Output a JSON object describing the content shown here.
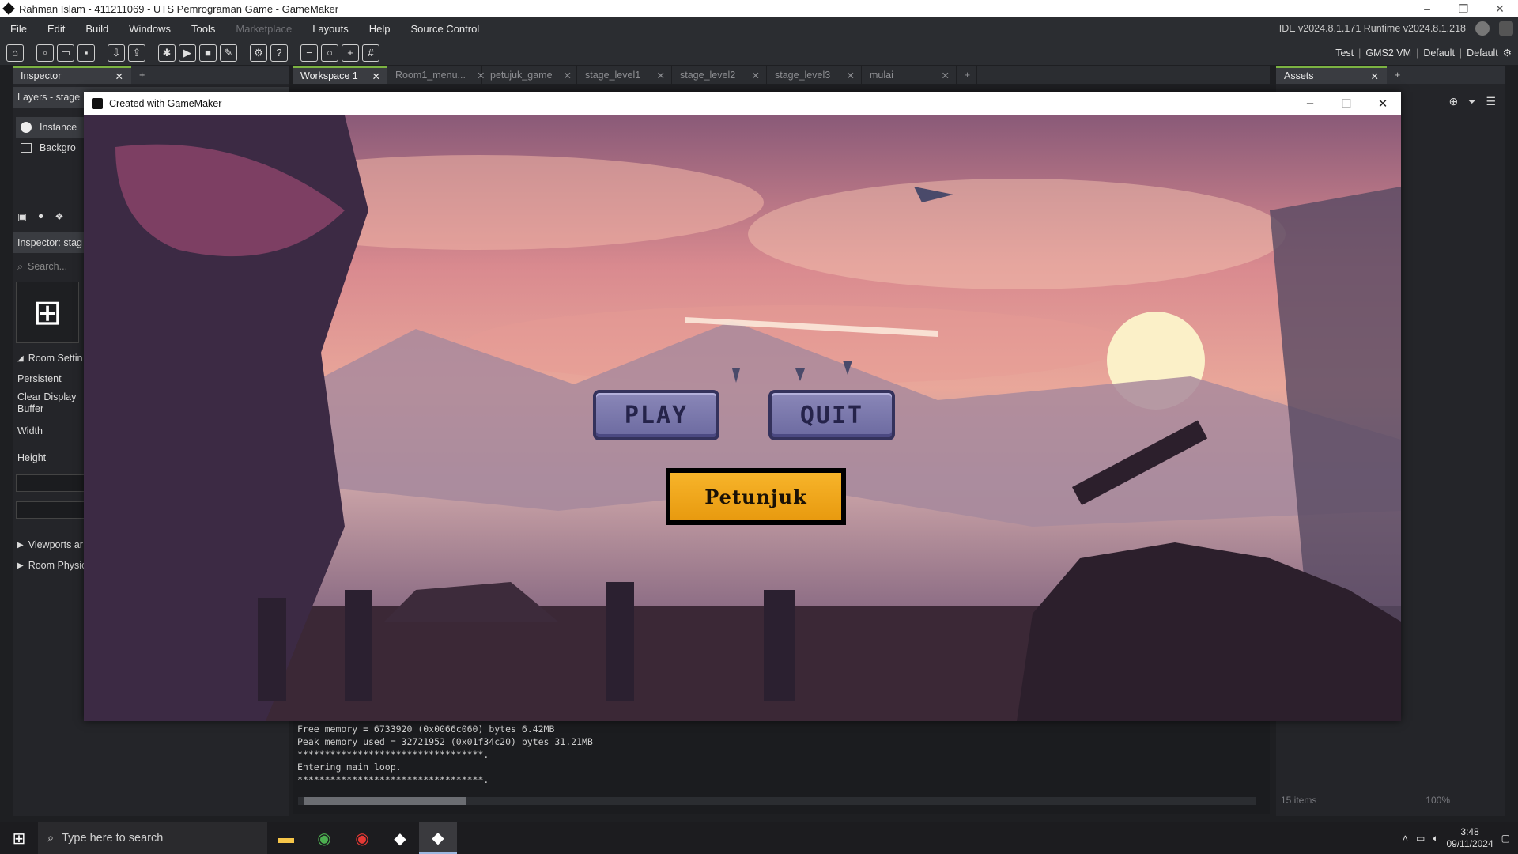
{
  "window": {
    "title": "Rahman Islam - 411211069 - UTS Pemrograman Game - GameMaker"
  },
  "menu": {
    "items": [
      "File",
      "Edit",
      "Build",
      "Windows",
      "Tools",
      "Marketplace",
      "Layouts",
      "Help",
      "Source Control"
    ],
    "version": "IDE v2024.8.1.171  Runtime v2024.8.1.218"
  },
  "toolbar": {
    "target_test": "Test",
    "target_vm": "GMS2 VM",
    "target_default1": "Default",
    "target_default2": "Default"
  },
  "left_panel": {
    "tab": "Inspector",
    "layers_header": "Layers - stage",
    "layer_instances": "Instance",
    "layer_background": "Backgro",
    "inspector_header": "Inspector: stag",
    "search_placeholder": "Search...",
    "room_settings": "Room Settin",
    "persistent": "Persistent",
    "clear_display_buffer": "Clear Display Buffer",
    "width": "Width",
    "height": "Height",
    "viewports": "Viewports ar",
    "room_physics": "Room Physic"
  },
  "workspace_tabs": [
    "Workspace 1",
    "Room1_menu...",
    "petujuk_game",
    "stage_level1",
    "stage_level2",
    "stage_level3",
    "mulai"
  ],
  "output_lines": [
    "Free memory = 6733920 (0x0066c060) bytes 6.42MB",
    "Peak memory used = 32721952 (0x01f34c20) bytes 31.21MB",
    "**********************************.",
    "Entering main loop.",
    "**********************************."
  ],
  "assets_panel": {
    "tab": "Assets",
    "count": "15 items",
    "zoom": "100%"
  },
  "game_window": {
    "title": "Created with GameMaker",
    "play_label": "PLAY",
    "quit_label": "QUIT",
    "help_label": "Petunjuk"
  },
  "taskbar": {
    "search_placeholder": "Type here to search",
    "time": "3:48",
    "date": "09/11/2024"
  },
  "colors": {
    "accent_green": "#7cb342",
    "button_orange": "#f0a81c",
    "button_purple": "#7c79ae"
  }
}
